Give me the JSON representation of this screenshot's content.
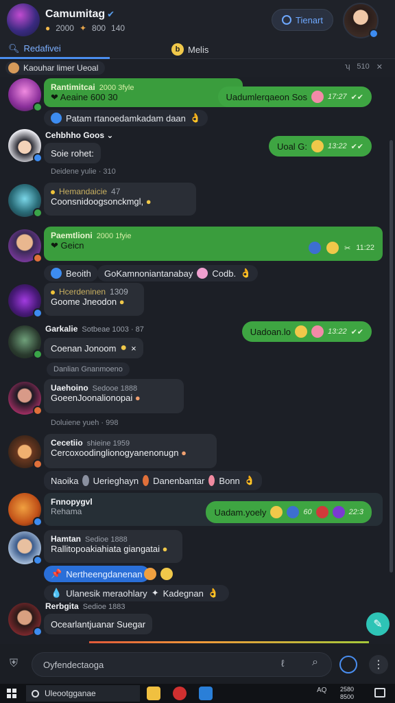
{
  "header": {
    "title": "Camumitag",
    "stats": [
      "2000",
      "800",
      "140"
    ],
    "join_label": "Tienart"
  },
  "tabs": {
    "active": "Redafivei",
    "other": "Melis"
  },
  "pinned": {
    "label": "Kaouhar limer Ueoal",
    "tools": "510"
  },
  "messages": [
    {
      "name": "Rantimitcai",
      "meta": "2000 3fyle",
      "text": "Aeaine 600 30",
      "reply": "Patam rtanoedamkadam daan"
    },
    {
      "name": "Cehbhho Goos",
      "meta": "",
      "text": "Soie rohet:",
      "sep": "Deidene yulie · 310"
    },
    {
      "name": "Hemandaicie",
      "meta": "47",
      "text": "Coonsnidoogsonckmgl,"
    },
    {
      "name": "Paemtlioni",
      "meta": "2000 1fyie",
      "text": "Geicn",
      "react1": "Beoith",
      "react2": "GoKamnoniantanabay",
      "react2b": "Codb."
    },
    {
      "name": "Hcerdeninen",
      "meta": "1309",
      "text": "Goome Jneodon"
    },
    {
      "name": "Garkalie",
      "meta": "Sotbeae 1003 · 87",
      "text": "Coenan Jonoom",
      "sep": "Danlian Gnanmoeno"
    },
    {
      "name": "Uaehoino",
      "meta": "Sedooe 1888",
      "text": "GoeenJoonalionopai",
      "sep": "Doluiene yueh · 998"
    },
    {
      "name": "Cecetiio",
      "meta": "shieine 1959",
      "text": "Cercoxoodinglionogyanenonugn",
      "reply": "Naoika",
      "reply2": "Uerieghayn",
      "reply3": "Danenbantar",
      "reply4": "Bonn"
    },
    {
      "name": "Fnnopygvl",
      "meta": "",
      "text": "Rehama"
    },
    {
      "name": "Hamtan",
      "meta": "Sedioe 1888",
      "text": "Rallitopoakiahiata giangatai",
      "tag": "Nertheengdanenan",
      "extra": "Ulanesik meraohlary",
      "extra2": "Kadegnan"
    },
    {
      "name": "Rerbgita",
      "meta": "Sedioe 1883",
      "text": "Ocearlantjuanar Suegar"
    }
  ],
  "outgoing": [
    {
      "text": "Uadumlerqaeon Sos",
      "time": "17:27"
    },
    {
      "text": "Uoal G:",
      "time": "13:22"
    },
    {
      "text": "",
      "time": "11:22"
    },
    {
      "text": "Uadoan.lo",
      "time": "13:22"
    },
    {
      "text": "Uadam.yoely",
      "time": "22:3"
    }
  ],
  "composer": {
    "placeholder": "Oyfendectaoga"
  },
  "taskbar": {
    "search": "Uleootgganae",
    "tray": "AQ",
    "clock1": "2580",
    "clock2": "8500"
  }
}
